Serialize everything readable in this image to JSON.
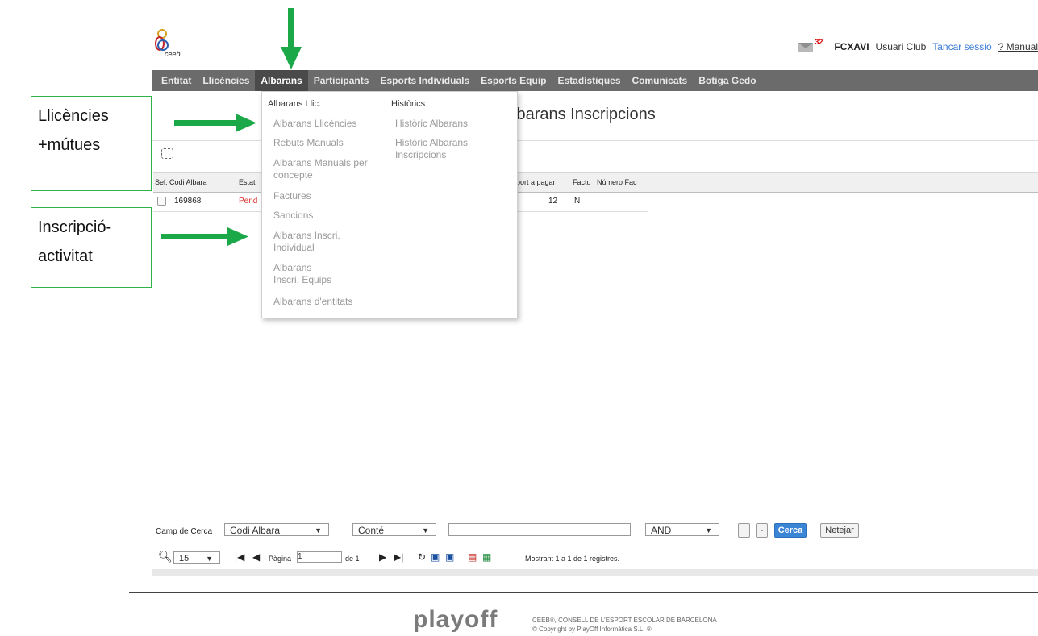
{
  "header": {
    "logo_text": "ceeb",
    "mail_count": "32",
    "user_code": "FCXAVI",
    "user_role": "Usuari Club",
    "logout": "Tancar sessió",
    "manual": "? Manual"
  },
  "nav": {
    "items": [
      "Entitat",
      "Llicències",
      "Albarans",
      "Participants",
      "Esports Individuals",
      "Esports Equip",
      "Estadístiques",
      "Comunicats",
      "Botiga Gedo"
    ],
    "active": "Albarans"
  },
  "page": {
    "title": "lbarans Inscripcions"
  },
  "menu": {
    "col1_header": "Albarans Llic.",
    "col1_items": [
      "Albarans Llicències",
      "Rebuts Manuals",
      "Albarans Manuals per concepte",
      "Factures",
      "Sancions",
      "Albarans Inscri. Individual",
      "Albarans Inscri. Equips",
      "Albarans d'entitats"
    ],
    "col2_header": "Històrics",
    "col2_items": [
      "Històric Albarans",
      "Històric Albarans Inscripcions"
    ]
  },
  "table": {
    "columns": [
      "Sel.",
      "Codi Albara",
      "Estat",
      "port a pagar",
      "Factu",
      "Número Fac"
    ],
    "rows": [
      {
        "codi": "169868",
        "estat": "Pend",
        "import": "12",
        "factu": "N",
        "numero": ""
      }
    ]
  },
  "search": {
    "label": "Camp de Cerca",
    "field": "Codi Albara",
    "operator": "Conté",
    "value": "",
    "logic": "AND",
    "add": "+",
    "remove": "-",
    "search_btn": "Cerca",
    "clear_btn": "Netejar"
  },
  "pager": {
    "page_size": "15",
    "page_label": "Pàgina",
    "page_value": "1",
    "of_label": "de 1",
    "status": "Mostrant 1 a 1 de 1 registres."
  },
  "footer": {
    "logo": "playoff",
    "line1": "CEEB®, CONSELL DE L'ESPORT ESCOLAR DE BARCELONA",
    "line2": "© Copyright by PlayOff Informàtica S.L. ®"
  },
  "annotations": {
    "box1": "Llicències +mútues",
    "box2": "Inscripció-activitat"
  },
  "colors": {
    "nav_bg": "#6b6b6b",
    "arrow_green": "#1aa848",
    "status_red": "#d9342b",
    "primary_btn": "#3a85d6"
  }
}
